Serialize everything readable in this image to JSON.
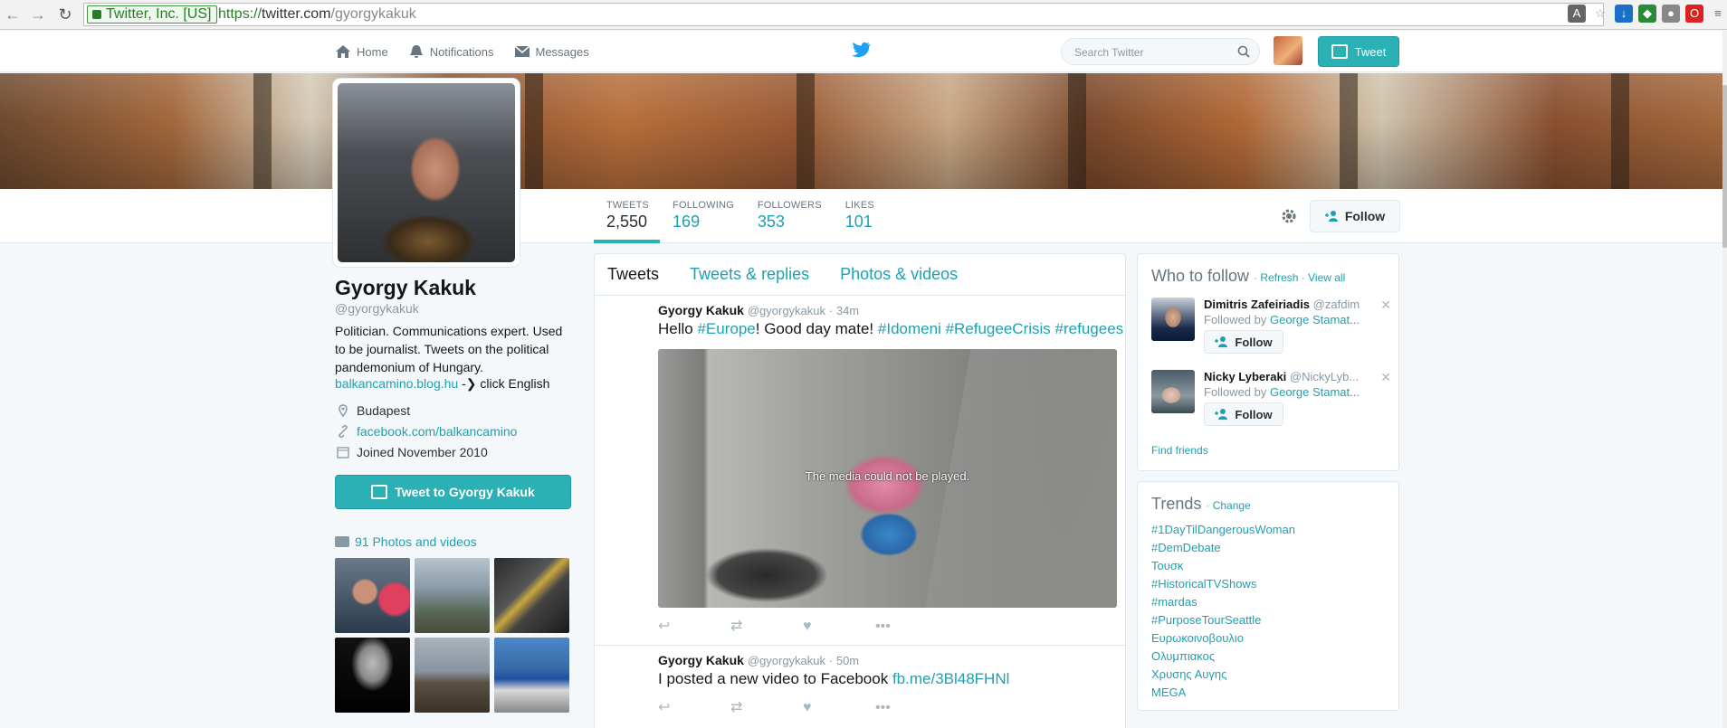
{
  "browser": {
    "secure_label": "Twitter, Inc. [US]",
    "url_scheme": "https://",
    "url_host": "twitter.com",
    "url_path": "/gyorgykakuk"
  },
  "topbar": {
    "nav": [
      {
        "label": "Home",
        "icon": "home-icon"
      },
      {
        "label": "Notifications",
        "icon": "bell-icon"
      },
      {
        "label": "Messages",
        "icon": "envelope-icon"
      }
    ],
    "search_placeholder": "Search Twitter",
    "tweet_label": "Tweet",
    "accent": "#2bb0b5"
  },
  "profile": {
    "name": "Gyorgy Kakuk",
    "handle": "@gyorgykakuk",
    "bio": "Politician. Communications expert. Used to be journalist. Tweets on the political pandemonium of Hungary.",
    "bio_link": "balkancamino.blog.hu",
    "bio_link_suffix": " -❯ click English",
    "location": "Budapest",
    "website": "facebook.com/balkancamino",
    "joined": "Joined November 2010",
    "tweet_to_label": "Tweet to Gyorgy Kakuk",
    "photos_label": "91 Photos and videos"
  },
  "stats": [
    {
      "label": "TWEETS",
      "value": "2,550",
      "active": true
    },
    {
      "label": "FOLLOWING",
      "value": "169",
      "active": false
    },
    {
      "label": "FOLLOWERS",
      "value": "353",
      "active": false
    },
    {
      "label": "LIKES",
      "value": "101",
      "active": false
    }
  ],
  "follow_label": "Follow",
  "timeline": {
    "tabs": [
      "Tweets",
      "Tweets & replies",
      "Photos & videos"
    ],
    "tweets": [
      {
        "name": "Gyorgy Kakuk",
        "handle": "@gyorgykakuk",
        "time": "· 34m",
        "text_prefix": "Hello ",
        "text_tag1": "#Europe",
        "text_mid": "! Good day mate! ",
        "text_tag2": "#Idomeni",
        "text_tag3": "#RefugeeCrisis",
        "text_tag4": "#refugees",
        "media_message": "The media could not be played."
      },
      {
        "name": "Gyorgy Kakuk",
        "handle": "@gyorgykakuk",
        "time": "· 50m",
        "text_prefix": "I posted a new video to Facebook ",
        "text_link": "fb.me/3Bl48FHNl"
      }
    ]
  },
  "who_to_follow": {
    "title": "Who to follow",
    "refresh": "Refresh",
    "view_all": "View all",
    "sep": " · ",
    "users": [
      {
        "name": "Dimitris Zafeiriadis",
        "handle": "@zafdim",
        "followed_by_prefix": "Followed by ",
        "followed_by": "George Stamat..."
      },
      {
        "name": "Nicky Lyberaki",
        "handle": "@NickyLyb...",
        "followed_by_prefix": "Followed by ",
        "followed_by": "George Stamat..."
      }
    ],
    "find_friends": "Find friends"
  },
  "trends": {
    "title": "Trends",
    "change": "Change",
    "items": [
      "#1DayTilDangerousWoman",
      "#DemDebate",
      "Τουσκ",
      "#HistoricalTVShows",
      "#mardas",
      "#PurposeTourSeattle",
      "Ευρωκοινοβουλιο",
      "Ολυμπιακος",
      "Χρυσης Αυγης",
      "MEGA"
    ]
  }
}
